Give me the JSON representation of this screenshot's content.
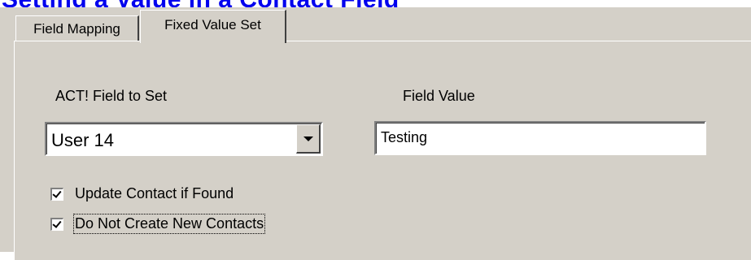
{
  "header_link": {
    "text": "Setting a Value in a Contact Field"
  },
  "tabs": [
    {
      "label": "Field Mapping",
      "active": false
    },
    {
      "label": "Fixed Value Set",
      "active": true
    }
  ],
  "form": {
    "act_field_label": "ACT! Field to Set",
    "act_field_selected": "User 14",
    "field_value_label": "Field Value",
    "field_value": "Testing"
  },
  "checkboxes": [
    {
      "label": "Update Contact if Found",
      "checked": true
    },
    {
      "label": "Do Not Create New Contacts",
      "checked": true,
      "focused": true
    }
  ],
  "colors": {
    "face": "#d4d0c8",
    "link": "#0000ee"
  }
}
